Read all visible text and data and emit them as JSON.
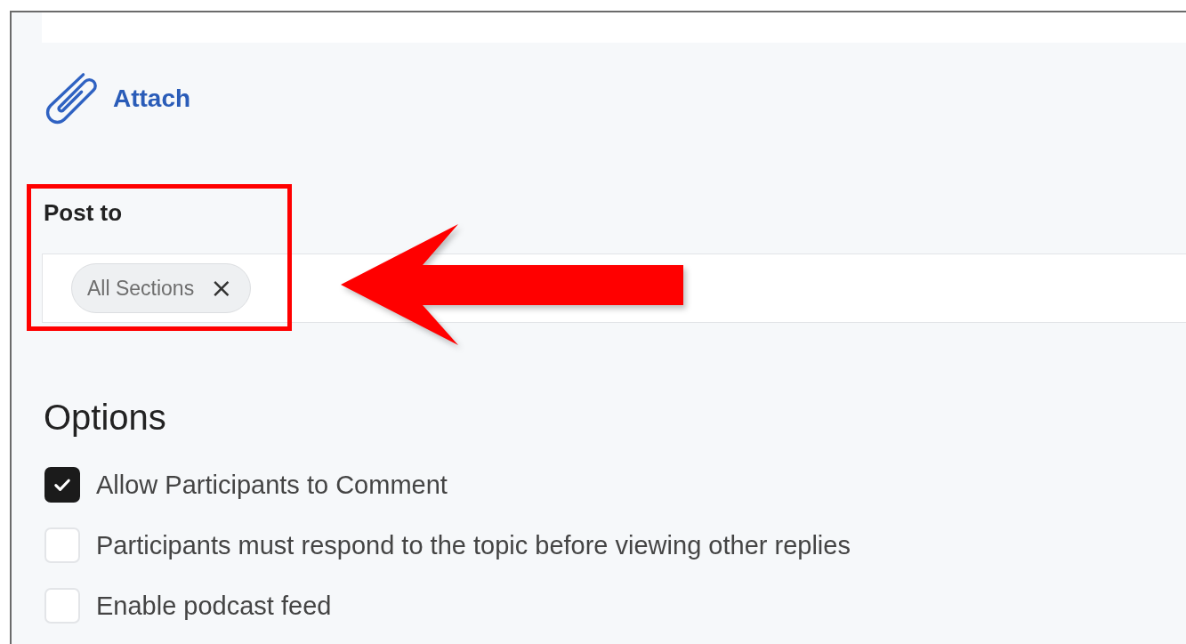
{
  "attach": {
    "label": "Attach"
  },
  "post_to": {
    "label": "Post to",
    "chips": [
      {
        "label": "All Sections",
        "remove": "×"
      }
    ]
  },
  "options": {
    "heading": "Options",
    "items": [
      {
        "label": "Allow Participants to Comment",
        "checked": true
      },
      {
        "label": "Participants must respond to the topic before viewing other replies",
        "checked": false
      },
      {
        "label": "Enable podcast feed",
        "checked": false
      }
    ]
  },
  "annotations": {
    "highlight_box": true,
    "arrow": true
  }
}
